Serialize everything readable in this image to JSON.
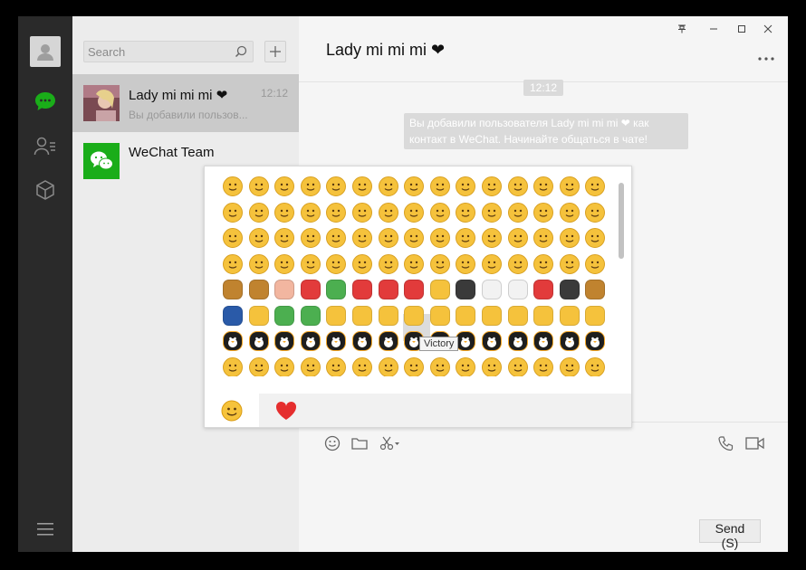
{
  "sidebar": {
    "items": [
      {
        "icon": "user-avatar-icon"
      },
      {
        "icon": "chat-bubble-icon",
        "active": true
      },
      {
        "icon": "contacts-icon"
      },
      {
        "icon": "favorites-box-icon"
      }
    ],
    "menu_icon": "hamburger-menu-icon"
  },
  "chat_list": {
    "search_placeholder": "Search",
    "chats": [
      {
        "name": "Lady mi mi mi ❤",
        "time": "12:12",
        "preview": "Вы добавили пользов...",
        "active": true
      },
      {
        "name": "WeChat Team",
        "time": "",
        "preview": "",
        "active": false
      }
    ]
  },
  "conversation": {
    "title": "Lady mi mi mi ❤",
    "time_badge": "12:12",
    "system_message": "Вы добавили пользователя Lady mi mi mi ❤ как контакт в WeChat. Начинайте общаться в чате!",
    "send_label": "Send (S)"
  },
  "window_controls": {
    "pin": "pin-icon",
    "minimize": "minimize-icon",
    "maximize": "maximize-icon",
    "close": "close-icon"
  },
  "emoji_panel": {
    "tooltip": "Victory",
    "tabs": [
      {
        "icon": "smiley-face-icon",
        "active": true
      },
      {
        "icon": "red-heart-icon",
        "active": false
      }
    ]
  },
  "colors": {
    "accent_green": "#1aad19",
    "rail_bg": "#2a2a2a",
    "list_bg": "#ececec",
    "active_chat_bg": "#cacaca"
  }
}
